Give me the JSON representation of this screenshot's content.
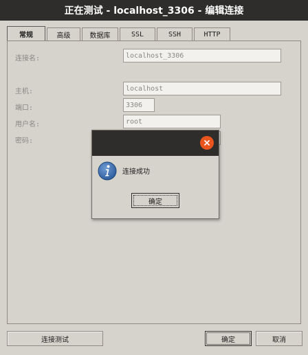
{
  "window": {
    "title": "正在测试 - localhost_3306 - 编辑连接"
  },
  "tabs": [
    {
      "label": "常规",
      "active": true
    },
    {
      "label": "高级",
      "active": false
    },
    {
      "label": "数据库",
      "active": false
    },
    {
      "label": "SSL",
      "active": false
    },
    {
      "label": "SSH",
      "active": false
    },
    {
      "label": "HTTP",
      "active": false
    }
  ],
  "form": {
    "connection_name_label": "连接名:",
    "connection_name_value": "localhost_3306",
    "host_label": "主机:",
    "host_value": "localhost",
    "port_label": "端口:",
    "port_value": "3306",
    "username_label": "用户名:",
    "username_value": "root",
    "password_label": "密码:"
  },
  "buttons": {
    "test_connection": "连接测试",
    "ok": "确定",
    "cancel": "取消"
  },
  "dialog": {
    "message": "连接成功",
    "ok_label": "确定",
    "close_icon": "close-icon",
    "info_icon": "info-icon"
  },
  "colors": {
    "titlebar": "#2e2d2b",
    "window_bg": "#d6d2cc",
    "close_button": "#e9541f",
    "info_icon": "#2f5f9e"
  }
}
